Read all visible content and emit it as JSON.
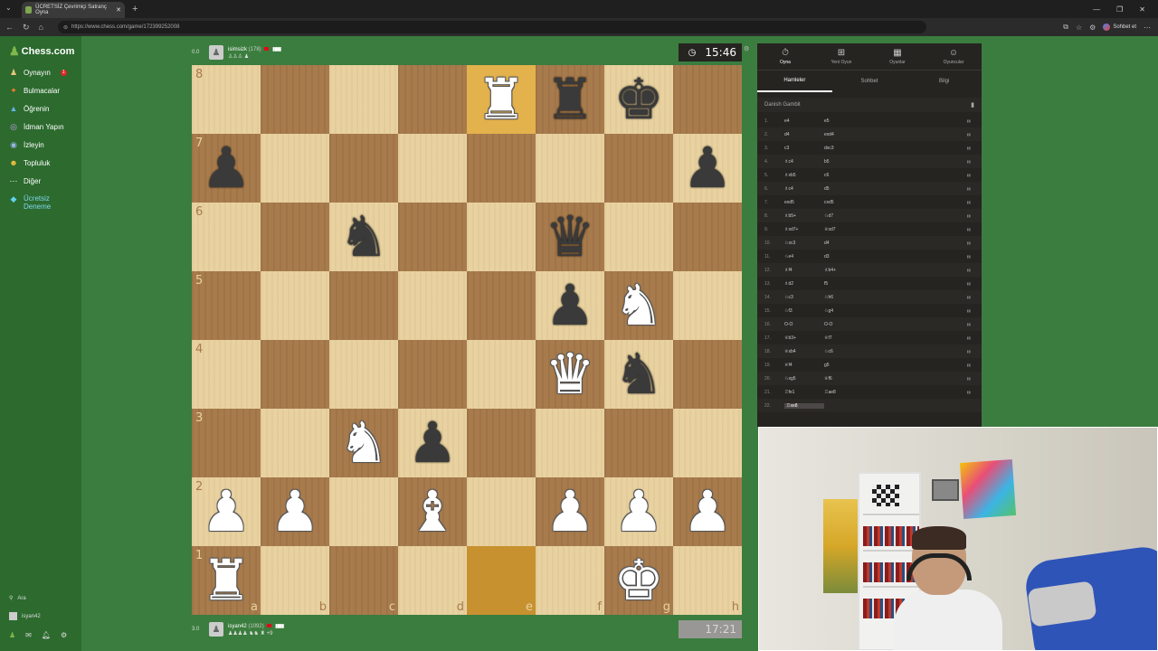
{
  "browser": {
    "tab_title": "ÜCRETSİZ Çevrimiçi Satranç Oyna",
    "url": "https://www.chess.com/game/172399252008",
    "profile_label": "Sohbet et"
  },
  "sidebar": {
    "logo": "Chess.com",
    "items": [
      {
        "label": "Oynayın",
        "icon": "pawn-icon",
        "badge": "1"
      },
      {
        "label": "Bulmacalar",
        "icon": "puzzle-icon"
      },
      {
        "label": "Öğrenin",
        "icon": "graduation-cap-icon"
      },
      {
        "label": "İdman Yapın",
        "icon": "drill-icon"
      },
      {
        "label": "İzleyin",
        "icon": "binoculars-icon"
      },
      {
        "label": "Topluluk",
        "icon": "community-icon"
      },
      {
        "label": "Diğer",
        "icon": "more-icon"
      },
      {
        "label": "Ücretsiz Deneme",
        "icon": "diamond-icon"
      }
    ],
    "search_label": "Ara",
    "user_label": "isyan42"
  },
  "top_player": {
    "score": "0.0",
    "name": "isimsizk",
    "rating": "(178)",
    "captured": "♙♙♙ ♟"
  },
  "bottom_player": {
    "score": "3.0",
    "name": "isyan42",
    "rating": "(1092)",
    "captured": "♟♟♟♟ ♞♞ ♜ +9"
  },
  "clocks": {
    "top": "15:46",
    "bottom": "17:21"
  },
  "board": {
    "orientation": "white",
    "highlight_squares": [
      "e8",
      "e1"
    ],
    "pieces": {
      "e8": "wR",
      "f8": "bR",
      "g8": "bK",
      "a7": "bP",
      "h7": "bP",
      "c6": "bN",
      "f6": "bQ",
      "f5": "bP",
      "g5": "wN",
      "f4": "wQ",
      "g4": "bN",
      "c3": "wN",
      "d3": "bP",
      "a2": "wP",
      "b2": "wP",
      "d2": "wB",
      "f2": "wP",
      "g2": "wP",
      "h2": "wP",
      "a1": "wR",
      "g1": "wK"
    },
    "ranks": [
      "8",
      "7",
      "6",
      "5",
      "4",
      "3",
      "2",
      "1"
    ],
    "files": [
      "a",
      "b",
      "c",
      "d",
      "e",
      "f",
      "g",
      "h"
    ]
  },
  "panel": {
    "top_tabs": [
      {
        "label": "Oyna",
        "icon": "stopwatch-icon"
      },
      {
        "label": "Yeni Oyun",
        "icon": "plus-icon"
      },
      {
        "label": "Oyunlar",
        "icon": "grid-icon"
      },
      {
        "label": "Oyuncular",
        "icon": "players-icon"
      }
    ],
    "sub_tabs": [
      "Hamleler",
      "Sohbet",
      "Bilgi"
    ],
    "opening": "Danish Gambit",
    "moves": [
      {
        "n": "1.",
        "w": "e4",
        "b": "e5"
      },
      {
        "n": "2.",
        "w": "d4",
        "b": "exd4"
      },
      {
        "n": "3.",
        "w": "c3",
        "b": "dxc3"
      },
      {
        "n": "4.",
        "w": "♗c4",
        "b": "b5"
      },
      {
        "n": "5.",
        "w": "♗xb5",
        "b": "c6"
      },
      {
        "n": "6.",
        "w": "♗c4",
        "b": "d5"
      },
      {
        "n": "7.",
        "w": "exd5",
        "b": "cxd5"
      },
      {
        "n": "8.",
        "w": "♗b5+",
        "b": "♘d7"
      },
      {
        "n": "9.",
        "w": "♗xd7+",
        "b": "♕xd7"
      },
      {
        "n": "10.",
        "w": "♘xc3",
        "b": "d4"
      },
      {
        "n": "11.",
        "w": "♘e4",
        "b": "d3"
      },
      {
        "n": "12.",
        "w": "♗f4",
        "b": "♗b4+"
      },
      {
        "n": "13.",
        "w": "♗d2",
        "b": "f5"
      },
      {
        "n": "14.",
        "w": "♘c3",
        "b": "♘h6"
      },
      {
        "n": "15.",
        "w": "♘f3",
        "b": "♘g4"
      },
      {
        "n": "16.",
        "w": "O-O",
        "b": "O-O"
      },
      {
        "n": "17.",
        "w": "♕b3+",
        "b": "♕f7"
      },
      {
        "n": "18.",
        "w": "♕xb4",
        "b": "♘c6"
      },
      {
        "n": "19.",
        "w": "♕f4",
        "b": "g5"
      },
      {
        "n": "20.",
        "w": "♘xg5",
        "b": "♕f6"
      },
      {
        "n": "21.",
        "w": "♖fe1",
        "b": "♖ae8"
      },
      {
        "n": "22.",
        "w": "♖xe8",
        "b": ""
      }
    ]
  }
}
